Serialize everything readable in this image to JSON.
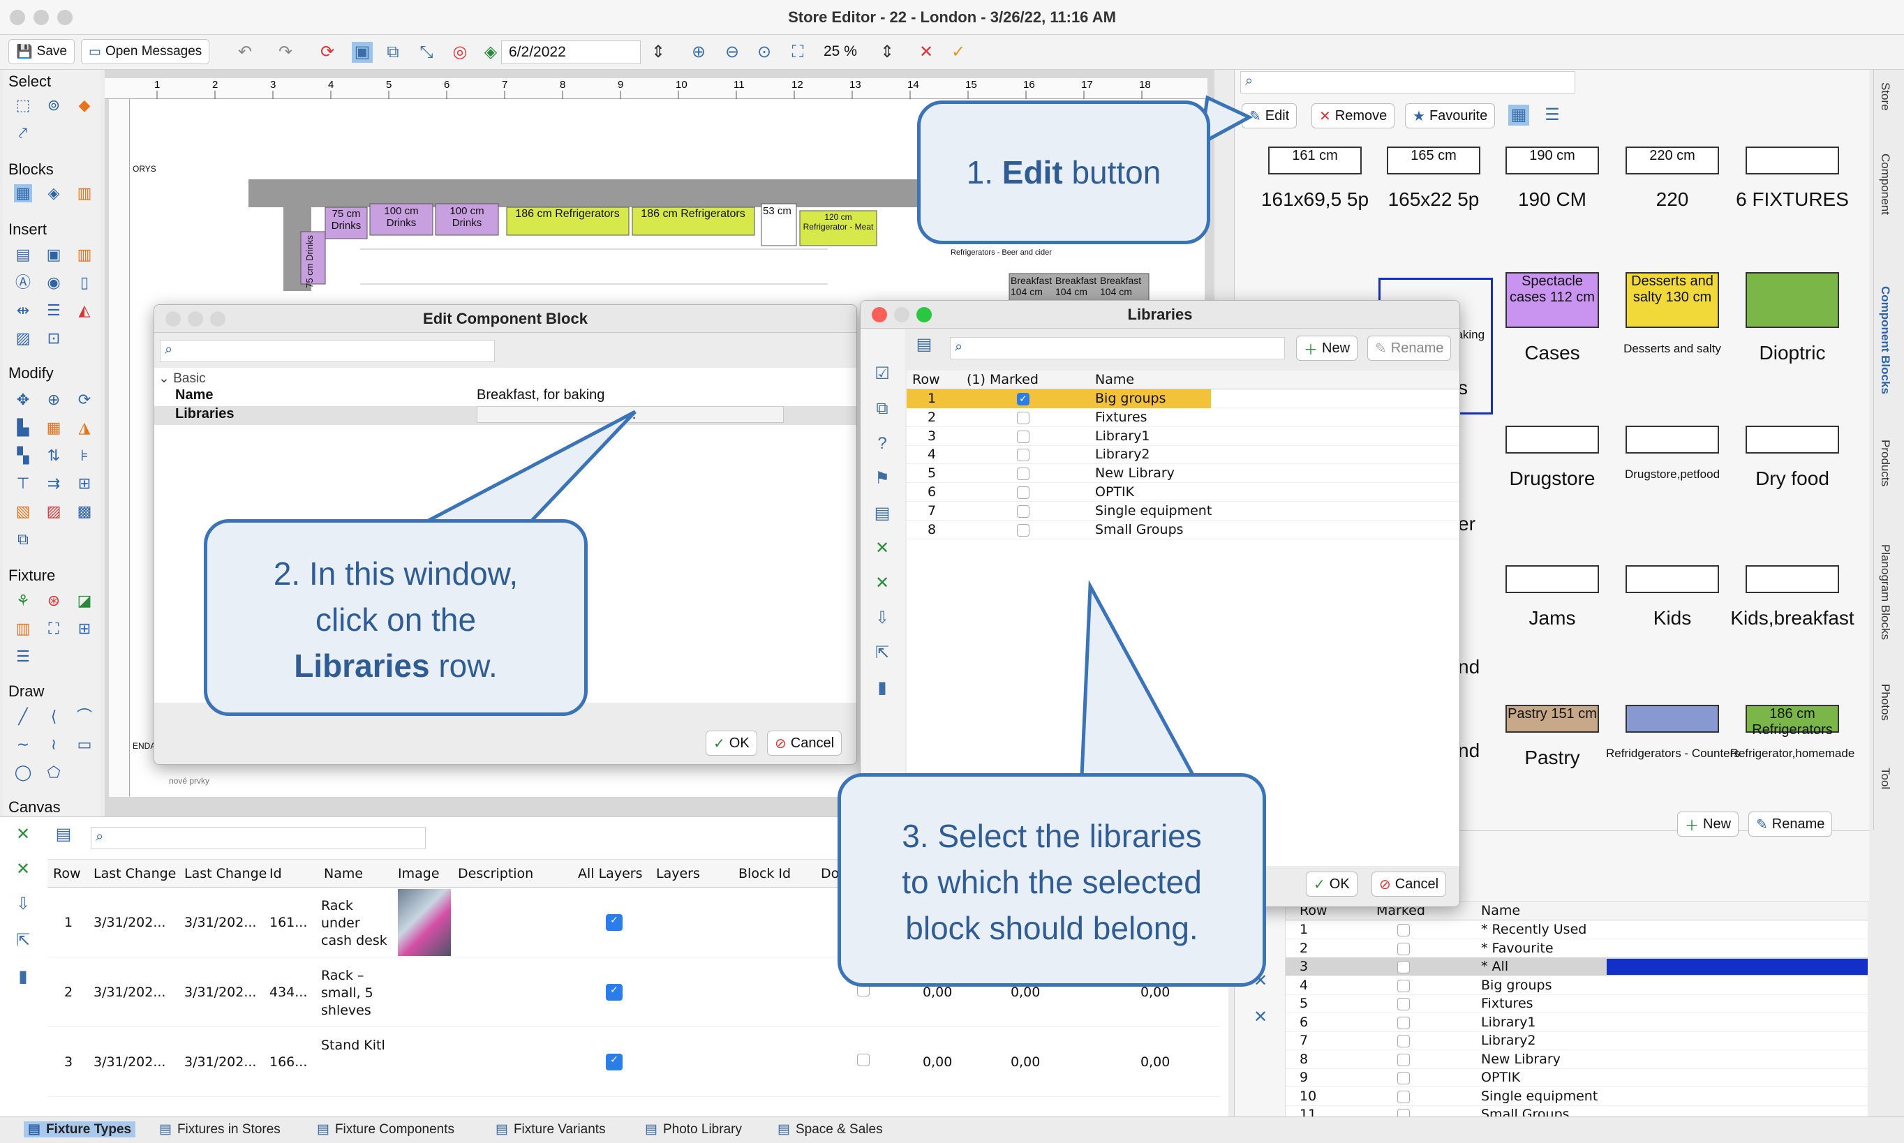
{
  "window": {
    "title": "Store Editor - 22 - London - 3/26/22, 11:16 AM"
  },
  "toolbar": {
    "save": "Save",
    "open_messages": "Open Messages",
    "date": "6/2/2022",
    "zoom": "25 %"
  },
  "left": {
    "select": "Select",
    "blocks": "Blocks",
    "insert": "Insert",
    "modify": "Modify",
    "fixture": "Fixture",
    "draw": "Draw",
    "canvas": "Canvas"
  },
  "canvas_labels": {
    "drinks1": "75 cm Drinks",
    "drinks2": "100 cm Drinks",
    "drinks3": "100 cm Drinks",
    "refr1": "186 cm Refrigerators",
    "refr2": "186 cm Refrigerators",
    "c53": "53 cm",
    "refmeat": "120 cm Refrigerator - Meat",
    "refbeer": "Refrigerators - Beer and cider",
    "vdrinks": "75 cm Drinks",
    "ory": "ORYS",
    "enda": "ENDA",
    "nove": "nové prvky",
    "b1": "Breakfast 104 cm",
    "b2": "Breakfast 104 cm",
    "b3": "Breakfast 104 cm"
  },
  "library": {
    "edit": "Edit",
    "remove": "Remove",
    "favourite": "Favourite",
    "items": [
      {
        "label": "161x69,5 5p",
        "box": "161 cm"
      },
      {
        "label": "165x22 5p",
        "box": "165 cm"
      },
      {
        "label": "190 CM",
        "box": "190 cm"
      },
      {
        "label": "220",
        "box": "220 cm"
      },
      {
        "label": "6 FIXTURES",
        "box": ""
      },
      {
        "label": "Cases",
        "box": "Spectacle cases 112 cm"
      },
      {
        "label": "Desserts and salty",
        "box": "Desserts and salty 130 cm"
      },
      {
        "label": "Dioptric",
        "box": ""
      },
      {
        "label": "Drugstore",
        "box": ""
      },
      {
        "label": "Drugstore,petfood",
        "box": ""
      },
      {
        "label": "Dry food",
        "box": ""
      },
      {
        "label": "Jams",
        "box": ""
      },
      {
        "label": "Kids",
        "box": ""
      },
      {
        "label": "Kids,breakfast",
        "box": ""
      },
      {
        "label": "Pastry",
        "box": "Pastry 151 cm"
      },
      {
        "label": "Refridgerators - Counters",
        "box": ""
      },
      {
        "label": "Refrigerator,homemade",
        "box": "186 cm Refrigerators"
      }
    ],
    "partial": [
      "baking",
      "s",
      "er",
      "nd",
      "nd"
    ],
    "new": "New",
    "rename": "Rename",
    "table": {
      "headers": [
        "Row",
        "Marked",
        "Name"
      ],
      "rows": [
        {
          "row": "1",
          "name": "* Recently Used"
        },
        {
          "row": "2",
          "name": "* Favourite"
        },
        {
          "row": "3",
          "name": "* All"
        },
        {
          "row": "4",
          "name": "Big groups"
        },
        {
          "row": "5",
          "name": "Fixtures"
        },
        {
          "row": "6",
          "name": "Library1"
        },
        {
          "row": "7",
          "name": "Library2"
        },
        {
          "row": "8",
          "name": "New Library"
        },
        {
          "row": "9",
          "name": "OPTIK"
        },
        {
          "row": "10",
          "name": "Single equipment"
        },
        {
          "row": "11",
          "name": "Small Groups"
        }
      ]
    }
  },
  "side_tabs": [
    "Store",
    "Component",
    "Component Blocks",
    "Products",
    "Planogram Blocks",
    "Photos",
    "Tool"
  ],
  "edit_dialog": {
    "title": "Edit Component Block",
    "group": "Basic",
    "name_label": "Name",
    "name_value": "Breakfast, for baking",
    "libraries_label": "Libraries",
    "libraries_value": "...",
    "ok": "OK",
    "cancel": "Cancel"
  },
  "libraries_dialog": {
    "title": "Libraries",
    "new": "New",
    "rename": "Rename",
    "headers": [
      "Row",
      "(1) Marked",
      "Name"
    ],
    "rows": [
      {
        "row": "1",
        "marked": true,
        "name": "Big groups"
      },
      {
        "row": "2",
        "marked": false,
        "name": "Fixtures"
      },
      {
        "row": "3",
        "marked": false,
        "name": "Library1"
      },
      {
        "row": "4",
        "marked": false,
        "name": "Library2"
      },
      {
        "row": "5",
        "marked": false,
        "name": "New Library"
      },
      {
        "row": "6",
        "marked": false,
        "name": "OPTIK"
      },
      {
        "row": "7",
        "marked": false,
        "name": "Single equipment"
      },
      {
        "row": "8",
        "marked": false,
        "name": "Small Groups"
      }
    ],
    "ok": "OK",
    "cancel": "Cancel"
  },
  "bottom_table": {
    "headers": [
      "Row",
      "Last Change",
      "Last Change",
      "Id",
      "Name",
      "Image",
      "Description",
      "All Layers",
      "Layers",
      "Block Id",
      "Do"
    ],
    "rows": [
      {
        "row": "1",
        "lc1": "3/31/202...",
        "lc2": "3/31/202...",
        "id": "161...",
        "name": "Rack under cash desk",
        "v1": "",
        "v2": "",
        "v3": ""
      },
      {
        "row": "2",
        "lc1": "3/31/202...",
        "lc2": "3/31/202...",
        "id": "434...",
        "name": "Rack – small, 5 shleves",
        "v1": "0,00",
        "v2": "0,00",
        "v3": "0,00"
      },
      {
        "row": "3",
        "lc1": "3/31/202...",
        "lc2": "3/31/202...",
        "id": "166...",
        "name": "Stand Kitl",
        "v1": "0,00",
        "v2": "0,00",
        "v3": "0,00"
      }
    ]
  },
  "bottom_tabs": [
    "Fixture Types",
    "Fixtures in Stores",
    "Fixture Components",
    "Fixture Variants",
    "Photo Library",
    "Space & Sales"
  ],
  "callouts": {
    "c1a": "1. ",
    "c1b": "Edit",
    "c1c": " button",
    "c2a": "2. In this window,",
    "c2b": "click on the",
    "c2c": "Libraries",
    "c2d": " row.",
    "c3a": "3. Select the libraries",
    "c3b": "to which the selected",
    "c3c": "block should belong."
  },
  "colors": {
    "accent": "#2b7de9",
    "callout_border": "#3b73b9",
    "callout_fill": "#e8eff7",
    "selected_row": "#f2c33a",
    "drinks": "#c8a0e0",
    "refrigerator": "#d6e84a"
  }
}
